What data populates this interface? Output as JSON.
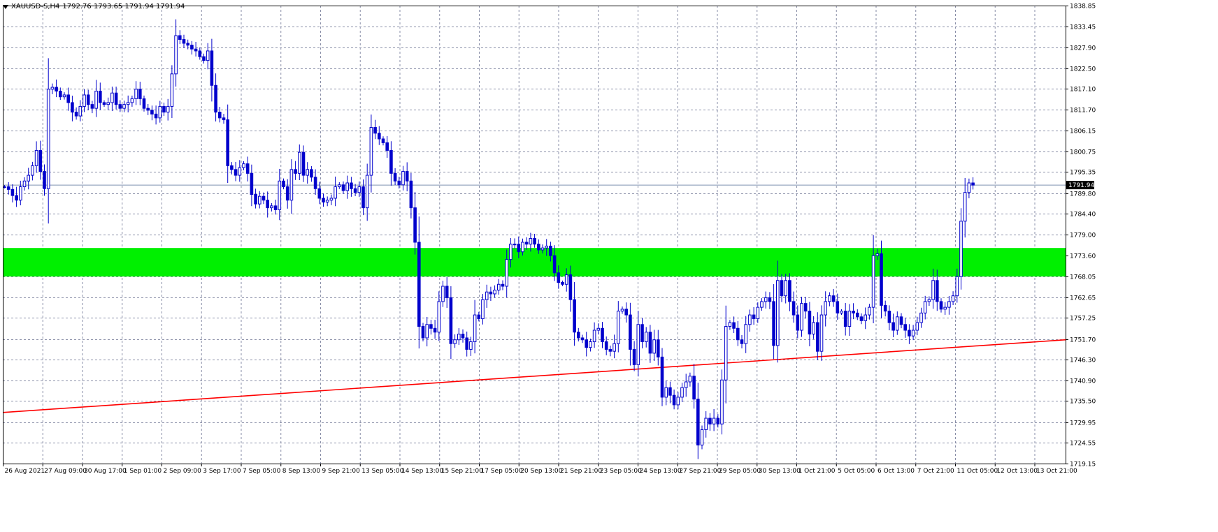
{
  "header": {
    "symbol": "XAUUSD-S,H4",
    "ohlc": "1792.76 1793.65 1791.94 1791.94"
  },
  "colors": {
    "candle": "#0000CC",
    "grid": "#8A8FA8",
    "zone": "#00F000",
    "trendline": "#FF0000",
    "bid_line": "#7F93B0",
    "axis_badge": "#000000"
  },
  "chart_data": {
    "type": "candlestick",
    "symbol": "XAUUSD-S",
    "timeframe": "H4",
    "ylim": [
      1719.15,
      1838.85
    ],
    "y_ticks": [
      "1838.85",
      "1833.45",
      "1827.90",
      "1822.50",
      "1817.10",
      "1811.70",
      "1806.15",
      "1800.75",
      "1795.35",
      "1789.80",
      "1784.40",
      "1779.00",
      "1773.60",
      "1768.05",
      "1762.65",
      "1757.25",
      "1751.70",
      "1746.30",
      "1740.90",
      "1735.50",
      "1729.95",
      "1724.55",
      "1719.15"
    ],
    "x_ticks": [
      "26 Aug 2021",
      "27 Aug 09:00",
      "30 Aug 17:00",
      "1 Sep 01:00",
      "2 Sep 09:00",
      "3 Sep 17:00",
      "7 Sep 05:00",
      "8 Sep 13:00",
      "9 Sep 21:00",
      "13 Sep 05:00",
      "14 Sep 13:00",
      "15 Sep 21:00",
      "17 Sep 05:00",
      "20 Sep 13:00",
      "21 Sep 21:00",
      "23 Sep 05:00",
      "24 Sep 13:00",
      "27 Sep 21:00",
      "29 Sep 05:00",
      "30 Sep 13:00",
      "1 Oct 21:00",
      "5 Oct 05:00",
      "6 Oct 13:00",
      "7 Oct 21:00",
      "11 Oct 05:00",
      "12 Oct 13:00",
      "13 Oct 21:00"
    ],
    "current_price": 1791.94,
    "current_price_label": "1791.94",
    "zone": {
      "from": 1768.05,
      "to": 1775.5
    },
    "trendline": {
      "from": 1732.5,
      "to": 1751.5
    },
    "close": [
      1791.5,
      1790.8,
      1789.2,
      1788.0,
      1791.5,
      1793.0,
      1794.5,
      1797.0,
      1801.0,
      1795.5,
      1791.0,
      1817.0,
      1817.5,
      1816.5,
      1815.0,
      1815.5,
      1813.5,
      1811.0,
      1810.0,
      1812.5,
      1815.5,
      1813.0,
      1812.0,
      1816.5,
      1813.5,
      1813.0,
      1813.5,
      1816.0,
      1813.0,
      1812.0,
      1813.0,
      1813.5,
      1814.5,
      1817.0,
      1814.5,
      1812.0,
      1811.5,
      1810.5,
      1809.5,
      1812.5,
      1811.0,
      1812.5,
      1821.0,
      1831.0,
      1830.0,
      1829.0,
      1828.5,
      1827.5,
      1827.0,
      1825.5,
      1824.5,
      1827.0,
      1818.0,
      1811.0,
      1809.5,
      1809.0,
      1797.0,
      1796.0,
      1794.5,
      1796.5,
      1797.5,
      1795.0,
      1789.5,
      1787.0,
      1789.0,
      1788.0,
      1786.0,
      1786.5,
      1785.5,
      1793.0,
      1791.5,
      1788.0,
      1796.0,
      1795.0,
      1800.5,
      1794.5,
      1796.0,
      1794.0,
      1791.0,
      1788.5,
      1787.5,
      1788.0,
      1788.5,
      1791.5,
      1792.0,
      1790.5,
      1792.5,
      1791.0,
      1790.0,
      1791.5,
      1786.0,
      1794.5,
      1807.0,
      1805.5,
      1804.0,
      1803.0,
      1801.0,
      1795.0,
      1793.0,
      1792.0,
      1795.5,
      1793.0,
      1786.0,
      1777.0,
      1755.0,
      1752.0,
      1755.5,
      1754.5,
      1753.5,
      1761.5,
      1765.5,
      1762.5,
      1750.5,
      1751.5,
      1753.0,
      1752.0,
      1749.0,
      1751.0,
      1758.0,
      1757.0,
      1762.0,
      1764.0,
      1763.5,
      1764.5,
      1766.0,
      1765.5,
      1772.5,
      1776.5,
      1776.5,
      1774.5,
      1777.0,
      1776.5,
      1778.0,
      1776.5,
      1775.0,
      1775.5,
      1776.0,
      1773.5,
      1769.0,
      1766.5,
      1766.0,
      1768.5,
      1762.0,
      1753.5,
      1752.0,
      1751.5,
      1749.5,
      1751.0,
      1754.0,
      1754.5,
      1751.0,
      1749.0,
      1748.5,
      1750.5,
      1759.0,
      1759.5,
      1758.0,
      1749.0,
      1745.0,
      1755.5,
      1751.0,
      1753.5,
      1748.0,
      1751.5,
      1747.0,
      1736.5,
      1739.0,
      1737.0,
      1734.5,
      1736.5,
      1739.0,
      1740.5,
      1742.0,
      1736.0,
      1724.0,
      1728.0,
      1731.0,
      1729.5,
      1731.0,
      1729.5,
      1741.0,
      1755.0,
      1756.0,
      1754.5,
      1751.5,
      1750.5,
      1755.5,
      1758.0,
      1757.0,
      1760.0,
      1761.5,
      1762.5,
      1761.5,
      1750.0,
      1767.0,
      1763.0,
      1767.0,
      1761.5,
      1758.0,
      1754.0,
      1761.0,
      1759.0,
      1753.0,
      1756.0,
      1748.5,
      1758.0,
      1761.5,
      1763.0,
      1761.5,
      1758.5,
      1759.0,
      1755.0,
      1759.0,
      1758.5,
      1757.5,
      1756.5,
      1758.0,
      1760.0,
      1773.5,
      1774.0,
      1760.5,
      1759.0,
      1756.0,
      1754.0,
      1757.5,
      1755.5,
      1754.0,
      1752.5,
      1754.0,
      1756.0,
      1758.5,
      1761.5,
      1762.0,
      1767.0,
      1761.5,
      1759.5,
      1760.0,
      1761.5,
      1763.0,
      1768.0,
      1782.5,
      1790.0,
      1792.5,
      1791.94
    ]
  }
}
